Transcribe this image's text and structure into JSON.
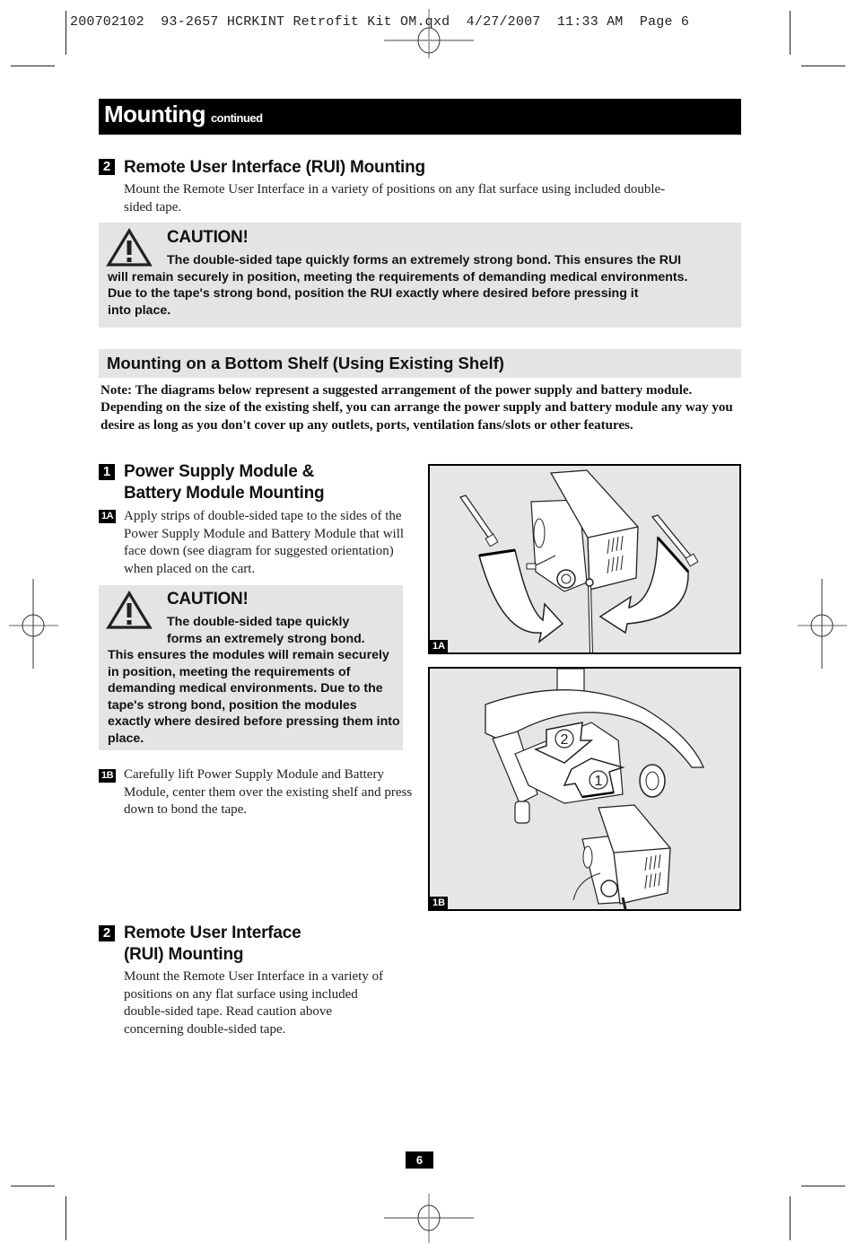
{
  "slug_line": "200702102  93-2657 HCRKINT Retrofit Kit OM.qxd  4/27/2007  11:33 AM  Page 6",
  "header": {
    "title": "Mounting",
    "subtitle": "continued"
  },
  "section_rui_top": {
    "number": "2",
    "heading": "Remote User Interface (RUI) Mounting",
    "body": "Mount the Remote User Interface in a variety of positions on any flat surface using included double-sided tape."
  },
  "caution_top": {
    "icon": "warning-triangle-icon",
    "title": "CAUTION!",
    "line1": "The double-sided tape quickly forms an extremely strong bond. This ensures the RUI",
    "line2": "will remain securely in position, meeting the requirements of demanding medical environments.",
    "line3": "Due to the tape's strong bond, position the RUI exactly where desired before pressing it",
    "line4": "into place."
  },
  "bottom_shelf": {
    "heading": "Mounting on a Bottom Shelf (Using Existing Shelf)",
    "note": "Note: The diagrams below represent a suggested arrangement of the power supply and battery module. Depending on the size of the existing shelf, you can arrange the power supply and battery module any way you desire as long as you don't cover up any outlets, ports, ventilation fans/slots or other features."
  },
  "step1": {
    "number": "1",
    "heading_line1": "Power Supply Module &",
    "heading_line2": "Battery Module Mounting",
    "sub_a": {
      "label": "1A",
      "text": "Apply strips of double-sided tape to the sides of the Power Supply Module and Battery Module that will face down (see diagram for suggested orientation) when placed on the cart."
    },
    "caution": {
      "icon": "warning-triangle-icon",
      "title": "CAUTION!",
      "line1": "The double-sided tape quickly",
      "line2": "forms an extremely strong bond.",
      "rest": "This ensures the modules will remain securely in position, meeting the requirements of demanding medical environments. Due to the tape's strong bond, position the modules exactly where desired before pressing them into place."
    },
    "sub_b": {
      "label": "1B",
      "text": "Carefully lift Power Supply Module and Battery Module, center them over the existing shelf and press down to bond the tape."
    }
  },
  "step2": {
    "number": "2",
    "heading_line1": "Remote User Interface",
    "heading_line2": "(RUI) Mounting",
    "body": "Mount the Remote User Interface in a variety of positions on any flat surface using included double-sided tape. Read caution above concerning double-sided tape."
  },
  "figures": {
    "fig_a": {
      "label": "1A",
      "description": "Tape strips applied to power supply and battery module"
    },
    "fig_b": {
      "label": "1B",
      "description": "Modules placed onto existing cart shelf",
      "marker_1": "1",
      "marker_2": "2"
    }
  },
  "footer": {
    "page_number": "6"
  }
}
